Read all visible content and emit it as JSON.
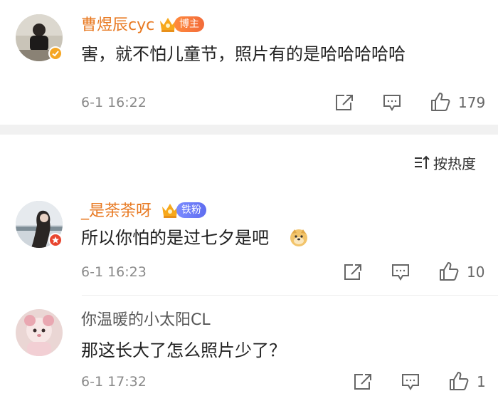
{
  "comments": [
    {
      "username": "曹煜辰cyc",
      "badge": "博主",
      "text": "害，就不怕儿童节，照片有的是哈哈哈哈哈",
      "time": "6-1 16:22",
      "likes": "179"
    },
    {
      "username": "_是荼荼呀",
      "badge": "铁粉",
      "text": "所以你怕的是过七夕是吧",
      "emoji": "doge-emoji",
      "time": "6-1 16:23",
      "likes": "10"
    },
    {
      "username": "你温暖的小太阳CL",
      "text": "那这长大了怎么照片少了？",
      "time": "6-1 17:32",
      "likes": "1"
    }
  ],
  "sort": {
    "label": "按热度"
  },
  "colors": {
    "username_highlight": "#e87a23",
    "verified_yellow": "#f5a623",
    "verified_red": "#e8452f",
    "fan_badge": "#5f6df0",
    "boss_badge": "#f26b3a"
  }
}
